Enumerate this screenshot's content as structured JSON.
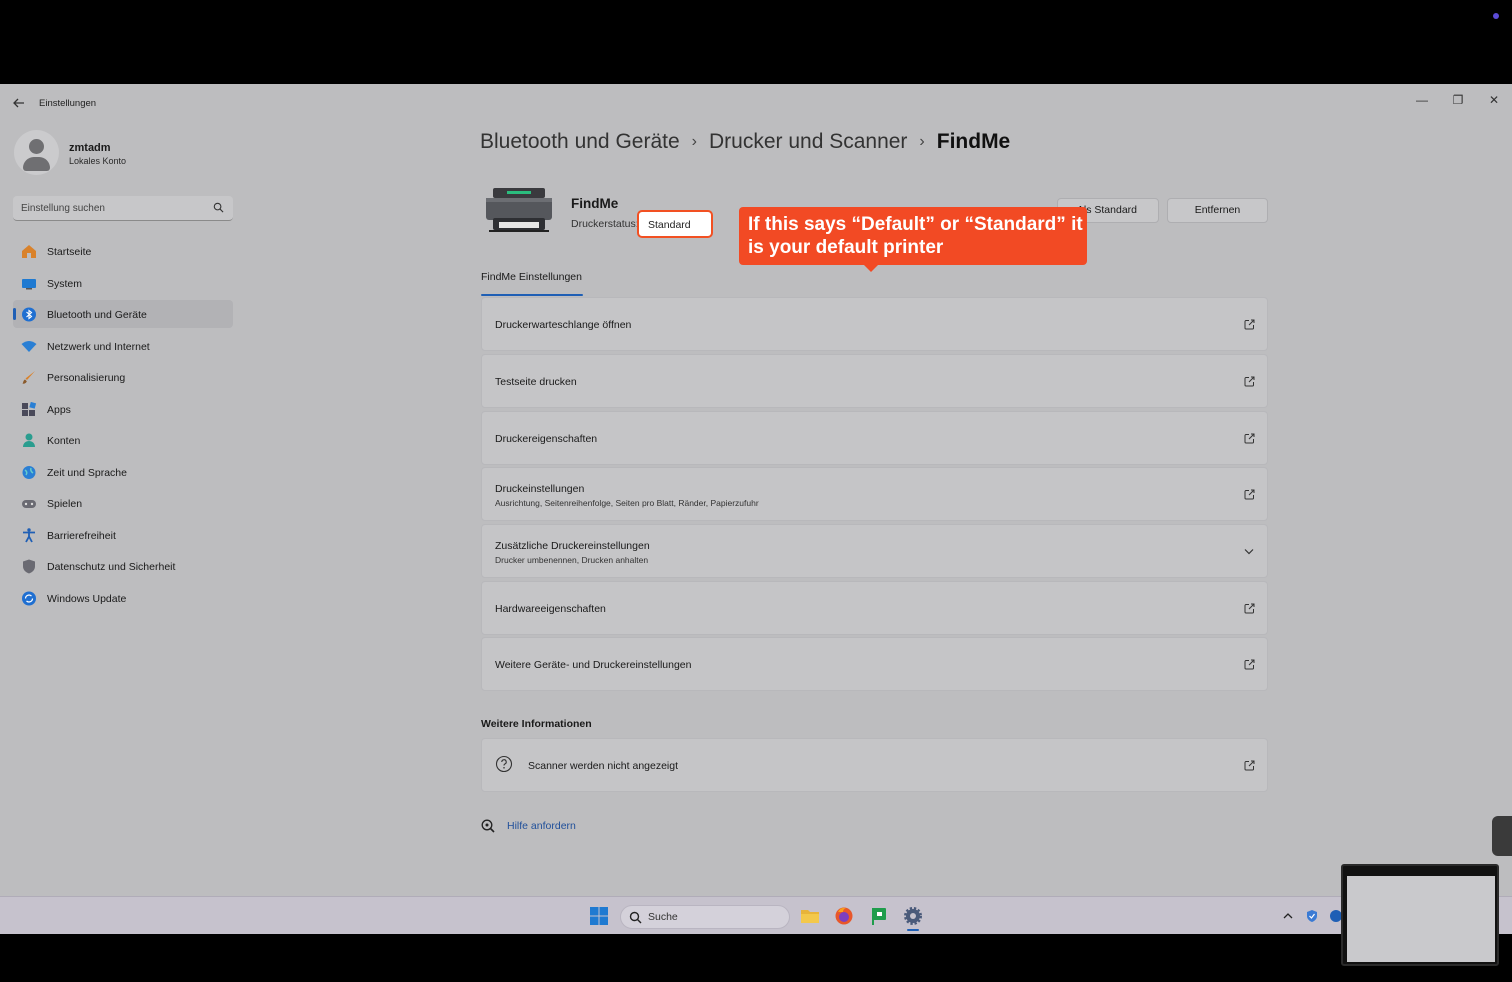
{
  "app": {
    "title": "Einstellungen",
    "window_controls": {
      "minimize": "—",
      "restore": "❐",
      "close": "✕"
    }
  },
  "profile": {
    "name": "zmtadm",
    "account_type": "Lokales Konto"
  },
  "search": {
    "placeholder": "Einstellung suchen"
  },
  "sidebar": {
    "items": [
      {
        "label": "Startseite",
        "icon": "home-icon"
      },
      {
        "label": "System",
        "icon": "monitor-icon"
      },
      {
        "label": "Bluetooth und Geräte",
        "icon": "bluetooth-icon",
        "active": true
      },
      {
        "label": "Netzwerk und Internet",
        "icon": "wifi-icon"
      },
      {
        "label": "Personalisierung",
        "icon": "brush-icon"
      },
      {
        "label": "Apps",
        "icon": "apps-icon"
      },
      {
        "label": "Konten",
        "icon": "account-icon"
      },
      {
        "label": "Zeit und Sprache",
        "icon": "globe-icon"
      },
      {
        "label": "Spielen",
        "icon": "gamepad-icon"
      },
      {
        "label": "Barrierefreiheit",
        "icon": "accessibility-icon"
      },
      {
        "label": "Datenschutz und Sicherheit",
        "icon": "shield-icon"
      },
      {
        "label": "Windows Update",
        "icon": "update-icon"
      }
    ]
  },
  "breadcrumb": {
    "items": [
      "Bluetooth und Geräte",
      "Drucker und Scanner"
    ],
    "current": "FindMe",
    "separator": "›"
  },
  "printer": {
    "name": "FindMe",
    "status_label": "Druckerstatus:",
    "status_value": "Standard"
  },
  "actions": {
    "set_default": "Als Standard",
    "remove": "Entfernen"
  },
  "callout": {
    "text": "If this says “Default” or “Standard” it is your default printer"
  },
  "tab": {
    "label": "FindMe Einstellungen"
  },
  "settings": [
    {
      "title": "Druckerwarteschlange öffnen",
      "subtitle": "",
      "action": "external"
    },
    {
      "title": "Testseite drucken",
      "subtitle": "",
      "action": "external"
    },
    {
      "title": "Druckereigenschaften",
      "subtitle": "",
      "action": "external"
    },
    {
      "title": "Druckeinstellungen",
      "subtitle": "Ausrichtung, Seitenreihenfolge, Seiten pro Blatt, Ränder, Papierzufuhr",
      "action": "external"
    },
    {
      "title": "Zusätzliche Druckereinstellungen",
      "subtitle": "Drucker umbenennen, Drucken anhalten",
      "action": "expand"
    },
    {
      "title": "Hardwareeigenschaften",
      "subtitle": "",
      "action": "external"
    },
    {
      "title": "Weitere Geräte- und Druckereinstellungen",
      "subtitle": "",
      "action": "external"
    }
  ],
  "more_info": {
    "heading": "Weitere Informationen",
    "item": "Scanner werden nicht angezeigt"
  },
  "help": {
    "label": "Hilfe anfordern"
  },
  "taskbar": {
    "search_placeholder": "Suche",
    "apps": [
      "file-explorer-icon",
      "firefox-icon",
      "green-flag-app-icon",
      "settings-gear-icon"
    ]
  },
  "colors": {
    "accent": "#1f5fb5",
    "callout": "#f24a24",
    "badge_border": "#f25022"
  }
}
